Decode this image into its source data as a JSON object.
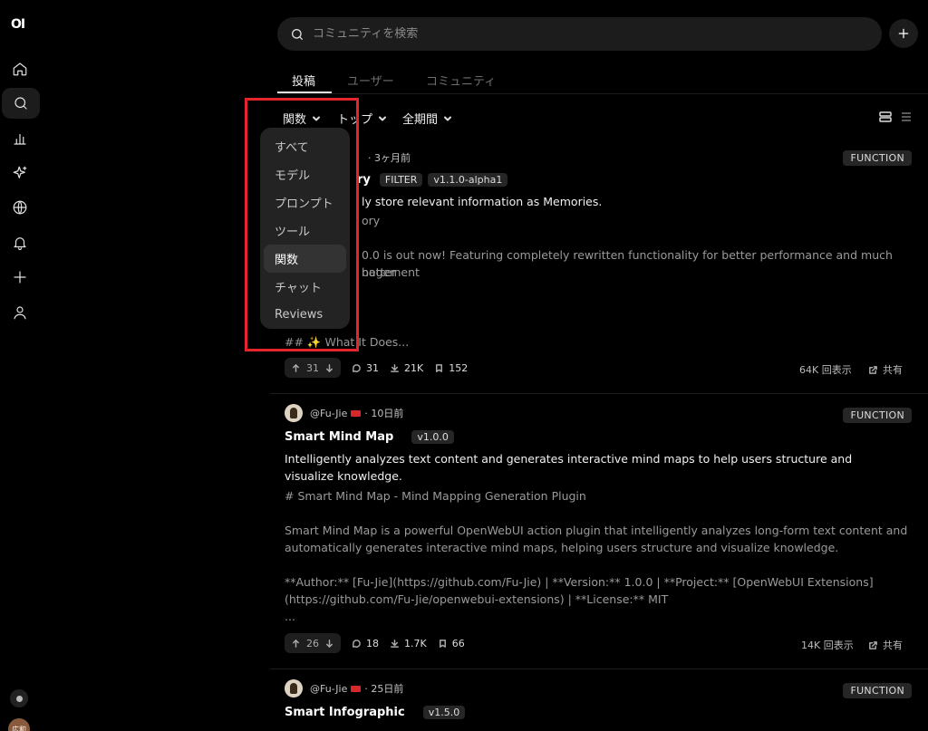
{
  "app": {
    "logo": "OI"
  },
  "sidebar": {
    "items": [
      {
        "name": "home-icon"
      },
      {
        "name": "search-icon"
      },
      {
        "name": "chart-icon"
      },
      {
        "name": "sparkle-icon"
      },
      {
        "name": "globe-icon"
      },
      {
        "name": "bell-icon"
      },
      {
        "name": "plus-icon"
      },
      {
        "name": "user-icon"
      }
    ],
    "avatar_text": "広和"
  },
  "search": {
    "placeholder": "コミュニティを検索"
  },
  "tabs": [
    {
      "label": "投稿",
      "active": true
    },
    {
      "label": "ユーザー",
      "active": false
    },
    {
      "label": "コミュニティ",
      "active": false
    }
  ],
  "filters": {
    "type": "関数",
    "sort": "トップ",
    "period": "全期間"
  },
  "dropdown": {
    "items": [
      "すべて",
      "モデル",
      "プロンプト",
      "ツール",
      "関数",
      "チャット",
      "Reviews"
    ],
    "selected": "関数"
  },
  "colors": {
    "highlight": "#e4252b",
    "background": "#000000"
  },
  "posts": [
    {
      "meta_time": "· 3ヶ月前",
      "badge": "FUNCTION",
      "title_fragment": "ry",
      "tags": [
        "FILTER",
        "v1.1.0-alpha1"
      ],
      "description": "ly store relevant information as Memories.",
      "body_line1": "ory",
      "body_line2": "0.0 is out now! Featuring completely rewritten functionality for better performance and much better",
      "body_line3": "nagement",
      "body_line4": "## ✨ What It Does...",
      "votes": "31",
      "comments": "31",
      "downloads": "21K",
      "saves": "152",
      "views": "64K 回表示",
      "share": "共有"
    },
    {
      "author": "@Fu-Jie",
      "meta_time": "· 10日前",
      "badge": "FUNCTION",
      "title": "Smart Mind Map",
      "tags": [
        "v1.0.0"
      ],
      "description": "Intelligently analyzes text content and generates interactive mind maps to help users structure and visualize knowledge.",
      "body_heading": "# Smart Mind Map - Mind Mapping Generation Plugin",
      "body_para": "Smart Mind Map is a powerful OpenWebUI action plugin that intelligently analyzes long-form text content and automatically generates interactive mind maps, helping users structure and visualize knowledge.",
      "body_para2": "**Author:** [Fu-Jie](https://github.com/Fu-Jie) | **Version:** 1.0.0 | **Project:** [OpenWebUI Extensions](https://github.com/Fu-Jie/openwebui-extensions) | **License:** MIT",
      "body_ellipsis": "...",
      "votes": "26",
      "comments": "18",
      "downloads": "1.7K",
      "saves": "66",
      "views": "14K 回表示",
      "share": "共有"
    },
    {
      "author": "@Fu-Jie",
      "meta_time": "· 25日前",
      "badge": "FUNCTION",
      "title": "Smart Infographic",
      "tags": [
        "v1.5.0"
      ]
    }
  ]
}
